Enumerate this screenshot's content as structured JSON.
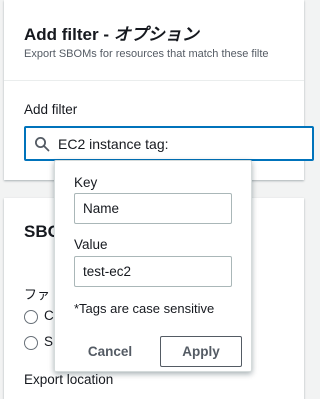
{
  "filter_card": {
    "title": "Add filter -",
    "title_suffix": "オプション",
    "description": "Export SBOMs for resources that match these filte",
    "field_label": "Add filter",
    "input_value": "EC2 instance tag:"
  },
  "sbom_card": {
    "heading": "SBO",
    "format_label": "ファ",
    "options": [
      {
        "label": "C"
      },
      {
        "label": "S"
      }
    ],
    "export_location_label": "Export location"
  },
  "popover": {
    "key_label": "Key",
    "key_value": "Name",
    "value_label": "Value",
    "value_value": "test-ec2",
    "note": "*Tags are case sensitive",
    "cancel_label": "Cancel",
    "apply_label": "Apply"
  },
  "colors": {
    "focus_border": "#0073bb",
    "text": "#16191f",
    "secondary_text": "#545b64"
  },
  "icons": {
    "search": "search-icon"
  }
}
